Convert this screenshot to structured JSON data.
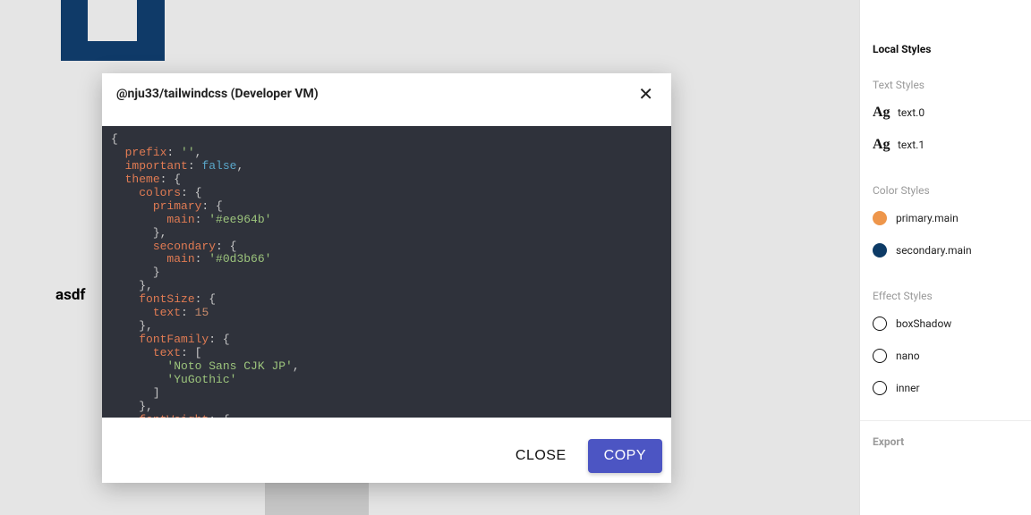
{
  "canvas": {
    "asdf_label": "asdf"
  },
  "modal": {
    "title": "@nju33/tailwindcss (Developer VM)",
    "close_button_label": "CLOSE",
    "copy_button_label": "COPY",
    "code": {
      "prefix_key": "prefix",
      "prefix_value": "''",
      "important_key": "important",
      "important_value": "false",
      "theme_key": "theme",
      "colors_key": "colors",
      "primary_key": "primary",
      "secondary_key": "secondary",
      "main_key": "main",
      "primary_main_value": "'#ee964b'",
      "secondary_main_value": "'#0d3b66'",
      "fontSize_key": "fontSize",
      "fontSize_text_key": "text",
      "fontSize_text_value": "15",
      "fontFamily_key": "fontFamily",
      "fontFamily_text_key": "text",
      "fontFamily_value_0": "'Noto Sans CJK JP'",
      "fontFamily_value_1": "'YuGothic'",
      "fontWeight_key": "fontWeight"
    }
  },
  "panel": {
    "title": "Local Styles",
    "text_styles_header": "Text Styles",
    "text_styles": [
      {
        "ag": "Ag",
        "label": "text.0"
      },
      {
        "ag": "Ag",
        "label": "text.1"
      }
    ],
    "color_styles_header": "Color Styles",
    "color_styles": [
      {
        "label": "primary.main",
        "swatch": "#ee964b"
      },
      {
        "label": "secondary.main",
        "swatch": "#0d3b66"
      }
    ],
    "effect_styles_header": "Effect Styles",
    "effect_styles": [
      {
        "label": "boxShadow"
      },
      {
        "label": "nano"
      },
      {
        "label": "inner"
      }
    ],
    "export_label": "Export"
  }
}
